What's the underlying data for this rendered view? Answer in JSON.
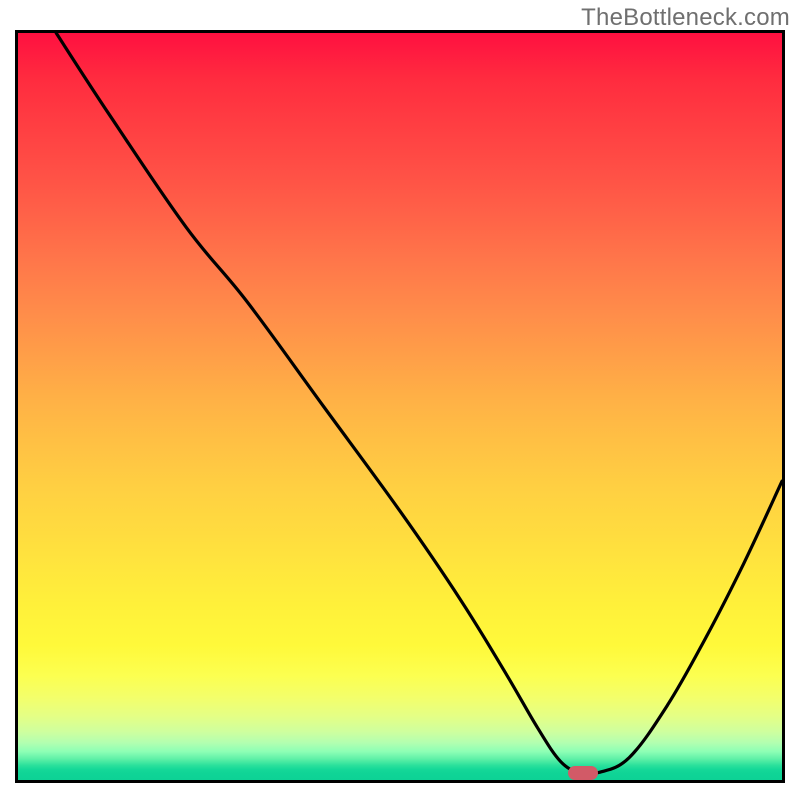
{
  "watermark": "TheBottleneck.com",
  "chart_data": {
    "type": "line",
    "title": "",
    "xlabel": "",
    "ylabel": "",
    "xlim": [
      0,
      100
    ],
    "ylim": [
      0,
      100
    ],
    "grid": false,
    "legend": false,
    "background": "red-yellow-green vertical gradient",
    "series": [
      {
        "name": "curve",
        "x": [
          5,
          12,
          22,
          30,
          40,
          50,
          58,
          64,
          68,
          71,
          73.5,
          76,
          80,
          85,
          90,
          95,
          100
        ],
        "y": [
          100,
          89,
          74,
          64,
          50,
          36,
          24,
          14,
          7,
          2.5,
          1,
          1,
          3,
          10,
          19,
          29,
          40
        ]
      }
    ],
    "annotations": [
      {
        "name": "minimum-marker",
        "shape": "rounded-rect",
        "x": 74,
        "y": 1,
        "color": "#d25a67"
      }
    ],
    "colors": {
      "curve": "#000000",
      "frame": "#000000",
      "gradient_top": "#ff1040",
      "gradient_mid": "#ffdc3f",
      "gradient_bottom": "#0dd295",
      "marker": "#d25a67",
      "watermark": "#6f6f6f"
    }
  }
}
